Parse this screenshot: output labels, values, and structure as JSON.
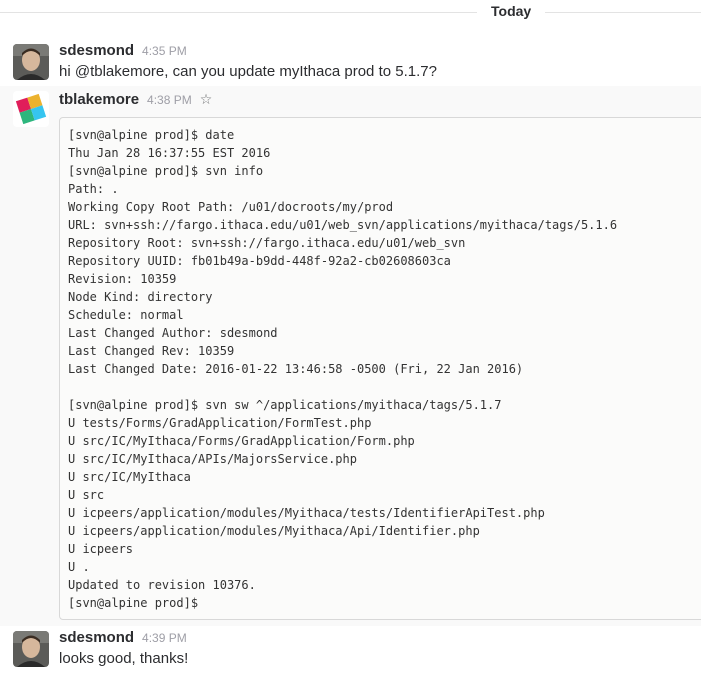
{
  "day_divider": {
    "label": "Today"
  },
  "messages": [
    {
      "user": "sdesmond",
      "time": "4:35 PM",
      "text": "hi @tblakemore, can you update myIthaca prod to 5.1.7?"
    },
    {
      "user": "tblakemore",
      "time": "4:38 PM",
      "star_icon": "star-outline-icon",
      "code_lines": [
        "[svn@alpine prod]$ date",
        "Thu Jan 28 16:37:55 EST 2016",
        "[svn@alpine prod]$ svn info",
        "Path: .",
        "Working Copy Root Path: /u01/docroots/my/prod",
        "URL: svn+ssh://fargo.ithaca.edu/u01/web_svn/applications/myithaca/tags/5.1.6",
        "Repository Root: svn+ssh://fargo.ithaca.edu/u01/web_svn",
        "Repository UUID: fb01b49a-b9dd-448f-92a2-cb02608603ca",
        "Revision: 10359",
        "Node Kind: directory",
        "Schedule: normal",
        "Last Changed Author: sdesmond",
        "Last Changed Rev: 10359",
        "Last Changed Date: 2016-01-22 13:46:58 -0500 (Fri, 22 Jan 2016)",
        "",
        "[svn@alpine prod]$ svn sw ^/applications/myithaca/tags/5.1.7",
        "U tests/Forms/GradApplication/FormTest.php",
        "U src/IC/MyIthaca/Forms/GradApplication/Form.php",
        "U src/IC/MyIthaca/APIs/MajorsService.php",
        "U src/IC/MyIthaca",
        "U src",
        "U icpeers/application/modules/Myithaca/tests/IdentifierApiTest.php",
        "U icpeers/application/modules/Myithaca/Api/Identifier.php",
        "U icpeers",
        "U .",
        "Updated to revision 10376.",
        "[svn@alpine prod]$"
      ]
    },
    {
      "user": "sdesmond",
      "time": "4:39 PM",
      "text": "looks good, thanks!"
    }
  ],
  "colors": {
    "accent_blue": "#36c5f0",
    "accent_green": "#2eb67d",
    "accent_yellow": "#ecb22e",
    "accent_red": "#e01e5a"
  }
}
